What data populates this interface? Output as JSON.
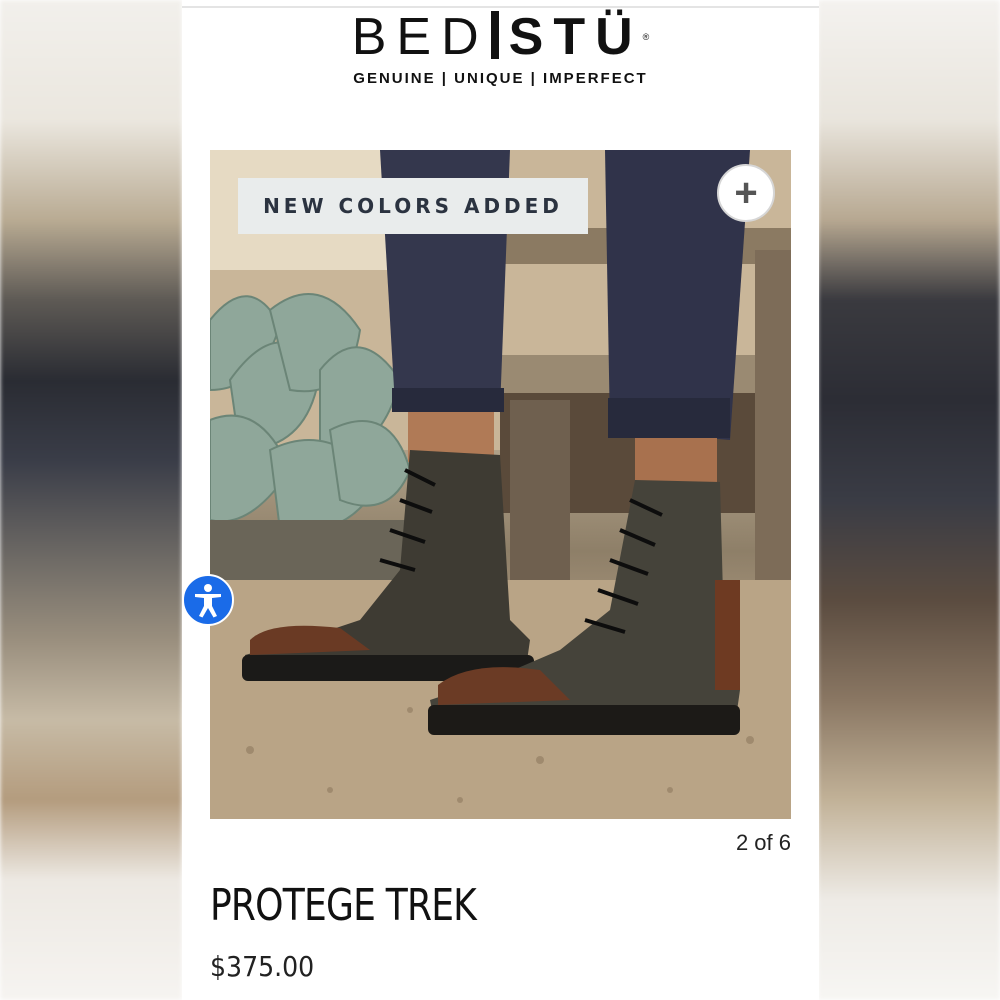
{
  "brand": {
    "logo_left": "BED",
    "logo_right": "STÜ",
    "logo_mark": "®",
    "tagline": "GENUINE | UNIQUE | IMPERFECT"
  },
  "gallery": {
    "banner": "NEW COLORS ADDED",
    "zoom_icon": "plus-icon",
    "counter": "2 of 6",
    "image_alt": "Protege Trek lace-up boots worn outdoors"
  },
  "accessibility": {
    "icon": "accessibility-icon",
    "color": "#1a6be8"
  },
  "product": {
    "name": "PROTEGE TREK",
    "price": "$375.00"
  }
}
